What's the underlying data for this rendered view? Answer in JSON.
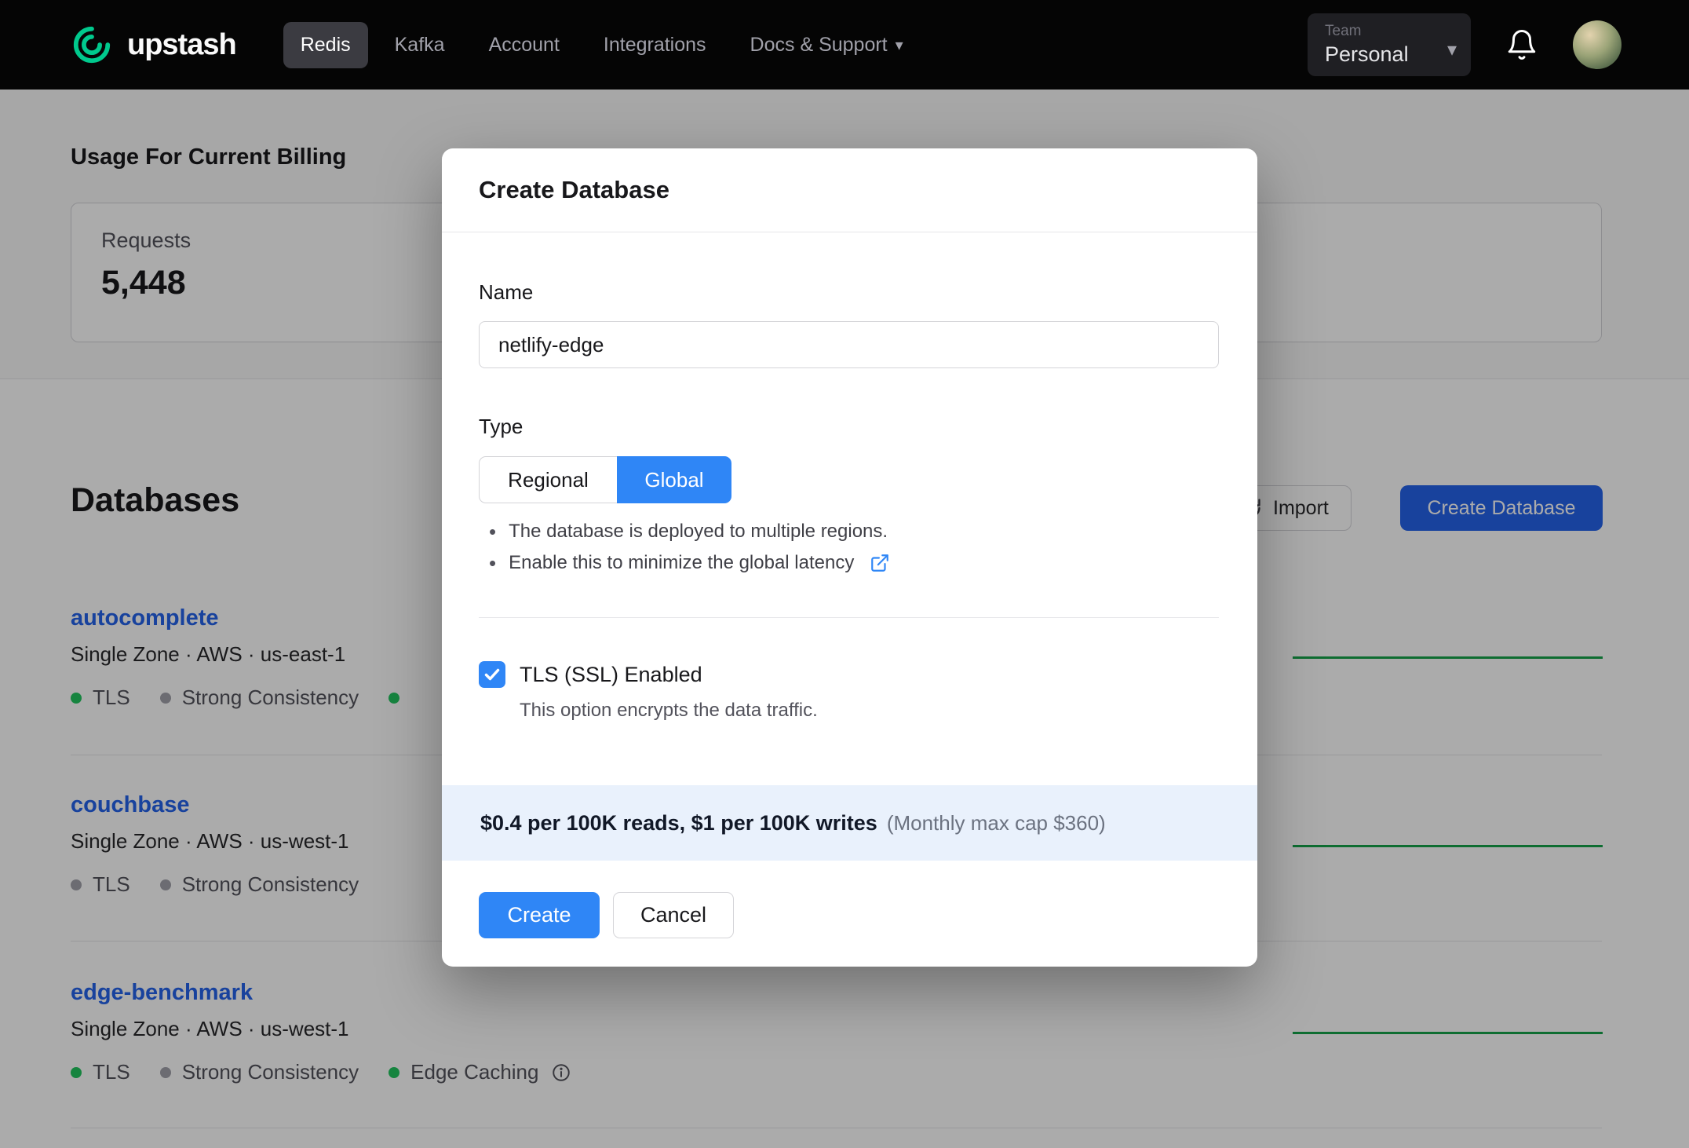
{
  "navbar": {
    "brand": "upstash",
    "items": [
      {
        "label": "Redis",
        "active": true
      },
      {
        "label": "Kafka",
        "active": false
      },
      {
        "label": "Account",
        "active": false
      },
      {
        "label": "Integrations",
        "active": false
      },
      {
        "label": "Docs & Support",
        "active": false
      }
    ],
    "team": {
      "label": "Team",
      "value": "Personal"
    }
  },
  "usage": {
    "title": "Usage For Current Billing",
    "requests": {
      "label": "Requests",
      "value": "5,448"
    }
  },
  "databases": {
    "title": "Databases",
    "import_button": "Import",
    "create_button": "Create Database",
    "rows": [
      {
        "name": "autocomplete",
        "subtitle": "Single Zone · AWS · us-east-1",
        "badges": [
          {
            "label": "TLS",
            "status": "green"
          },
          {
            "label": "Strong Consistency",
            "status": "gray"
          },
          {
            "label": "",
            "status": "green"
          }
        ]
      },
      {
        "name": "couchbase",
        "subtitle": "Single Zone · AWS · us-west-1",
        "badges": [
          {
            "label": "TLS",
            "status": "gray"
          },
          {
            "label": "Strong Consistency",
            "status": "gray"
          }
        ]
      },
      {
        "name": "edge-benchmark",
        "subtitle": "Single Zone · AWS · us-west-1",
        "badges": [
          {
            "label": "TLS",
            "status": "green"
          },
          {
            "label": "Strong Consistency",
            "status": "gray"
          },
          {
            "label": "Edge Caching",
            "status": "green"
          }
        ]
      }
    ]
  },
  "modal": {
    "title": "Create Database",
    "name": {
      "label": "Name",
      "value": "netlify-edge"
    },
    "type": {
      "label": "Type",
      "options": [
        "Regional",
        "Global"
      ],
      "selected": "Global"
    },
    "bullets": [
      "The database is deployed to multiple regions.",
      "Enable this to minimize the global latency"
    ],
    "tls": {
      "label": "TLS (SSL) Enabled",
      "help": "This option encrypts the data traffic.",
      "checked": true
    },
    "pricing": {
      "bold": "$0.4 per 100K reads, $1 per 100K writes",
      "note": "(Monthly max cap $360)"
    },
    "actions": {
      "create": "Create",
      "cancel": "Cancel"
    }
  },
  "colors": {
    "accent_blue": "#2f86f6",
    "dim_blue": "#2563eb",
    "success_green": "#16a34a",
    "badge_green": "#22c55e",
    "badge_gray": "#a1a1aa",
    "brand_green": "#00c98d"
  }
}
